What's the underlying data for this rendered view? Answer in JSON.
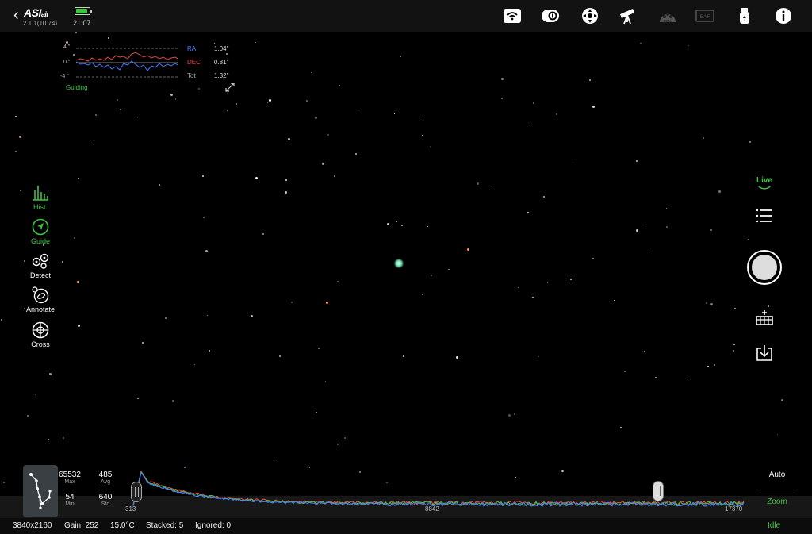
{
  "app": {
    "logo": "ASIair",
    "version": "2.1.1(10.74)",
    "time": "21:07",
    "battery_level": 0.9
  },
  "topbar": {
    "icons": [
      "wifi-icon",
      "camera-icon",
      "mount-control-icon",
      "telescope-icon",
      "efw-icon",
      "eaf-icon",
      "usb-storage-icon",
      "info-icon"
    ],
    "efw_label": "EFW",
    "eaf_label": "EAF"
  },
  "guiding": {
    "label": "Guiding",
    "ticks": [
      "4 \"",
      "0 \"",
      "-4 \""
    ],
    "ra": {
      "label": "RA",
      "value": "1.04\"",
      "color": "#4a7dff"
    },
    "dec": {
      "label": "DEC",
      "value": "0.81\"",
      "color": "#e84a4a"
    },
    "tot": {
      "label": "Tot",
      "value": "1.32\""
    }
  },
  "left_tools": [
    {
      "label": "Hist.",
      "icon": "histogram-icon",
      "active": true
    },
    {
      "label": "Guide",
      "icon": "guide-icon",
      "active": true
    },
    {
      "label": "Detect",
      "icon": "detect-icon",
      "active": false
    },
    {
      "label": "Annotate",
      "icon": "annotate-icon",
      "active": false
    },
    {
      "label": "Cross",
      "icon": "crosshair-icon",
      "active": false
    }
  ],
  "right_controls": {
    "live_label": "Live",
    "icons": [
      "menu-icon",
      "shutter-button",
      "focus-tool-icon",
      "save-icon"
    ]
  },
  "histogram": {
    "stats": {
      "max": {
        "value": "65532",
        "label": "Max"
      },
      "avg": {
        "value": "485",
        "label": "Avg"
      },
      "min": {
        "value": "54",
        "label": "Min"
      },
      "std": {
        "value": "640",
        "label": "Std"
      }
    },
    "low": "313",
    "mid": "8842",
    "high": "17370",
    "auto_label": "Auto",
    "zoom_label": "Zoom"
  },
  "status": {
    "resolution": "3840x2160",
    "gain": "Gain: 252",
    "temperature": "15.0°C",
    "stacked": "Stacked: 5",
    "ignored": "Ignored: 0",
    "state": "Idle"
  },
  "colors": {
    "accent": "#3ec43e",
    "ra": "#4a7dff",
    "dec": "#e84a4a"
  }
}
